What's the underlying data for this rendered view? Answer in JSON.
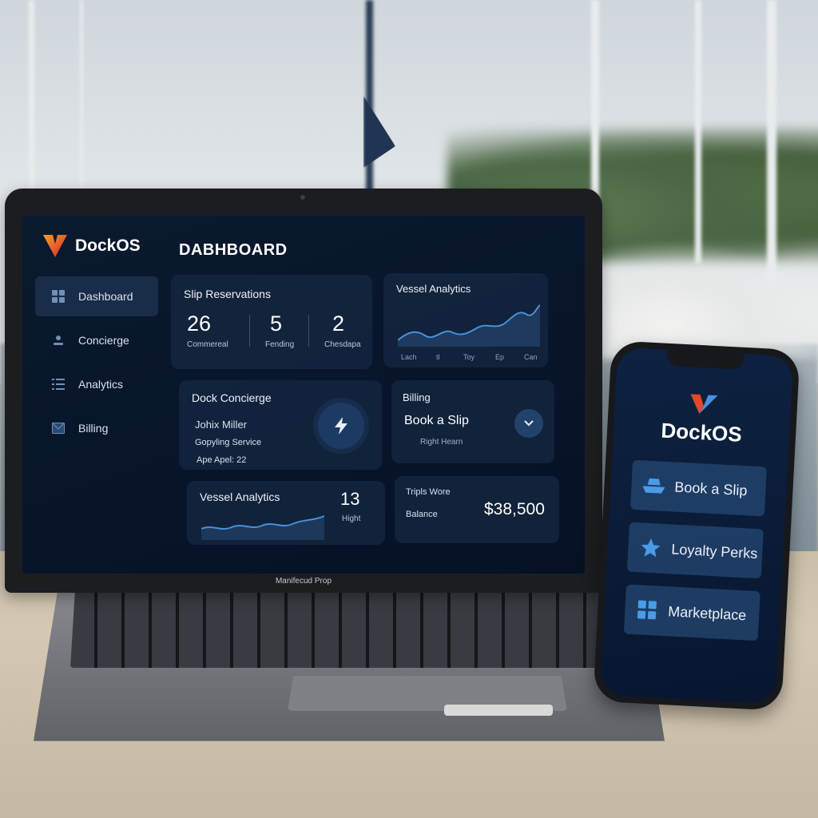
{
  "app": {
    "brand": "DockOS",
    "page_title": "DABHBOARD",
    "device_label": "Manifecud Prop"
  },
  "colors": {
    "accent": "#4a90d9",
    "brand_orange": "#f4a02a",
    "brand_red": "#e2482a",
    "screen_bg": "#07142a",
    "card_bg": "#162842"
  },
  "sidebar": {
    "items": [
      {
        "label": "Dashboard",
        "icon": "grid-icon",
        "active": true
      },
      {
        "label": "Concierge",
        "icon": "person-icon",
        "active": false
      },
      {
        "label": "Analytics",
        "icon": "list-icon",
        "active": false
      },
      {
        "label": "Billing",
        "icon": "envelope-icon",
        "active": false
      }
    ]
  },
  "slip_reservations": {
    "title": "Slip Reservations",
    "stats": [
      {
        "value": "26",
        "label": "Commereal"
      },
      {
        "value": "5",
        "label": "Fending"
      },
      {
        "value": "2",
        "label": "Chesdapa"
      }
    ]
  },
  "vessel_analytics_top": {
    "title": "Vessel Analytics",
    "ticks": [
      "Lach",
      "tl",
      "Toy",
      "Ep",
      "Can"
    ]
  },
  "dock_concierge": {
    "title": "Dock Concierge",
    "name": "Johix Miller",
    "service": "Gopyling Service",
    "detail": "Ape Apel: 22",
    "icon": "bolt-icon"
  },
  "billing": {
    "title": "Billing",
    "action": "Book a Slip",
    "sub": "Right Hearn",
    "icon": "chevron-down-icon"
  },
  "vessel_analytics_bottom": {
    "title": "Vessel Analytics",
    "value": "13",
    "value_label": "Hight"
  },
  "balance": {
    "label_top": "Tripls Wore",
    "label": "Balance",
    "amount": "$38,500"
  },
  "phone": {
    "brand": "DockOS",
    "buttons": [
      {
        "label": "Book a Slip",
        "icon": "boat-icon"
      },
      {
        "label": "Loyalty Perks",
        "icon": "star-icon"
      },
      {
        "label": "Marketplace",
        "icon": "grid-icon"
      }
    ]
  }
}
